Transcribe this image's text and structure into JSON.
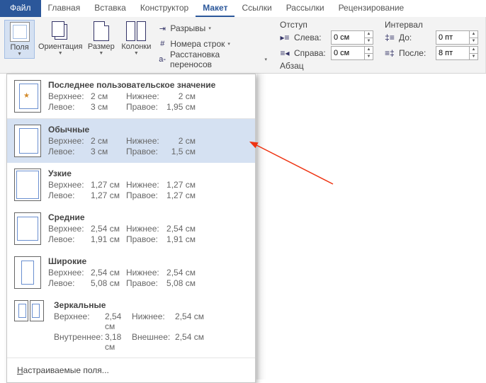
{
  "tabs": {
    "file": "Файл",
    "home": "Главная",
    "insert": "Вставка",
    "design": "Конструктор",
    "layout": "Макет",
    "references": "Ссылки",
    "mailings": "Рассылки",
    "review": "Рецензирование"
  },
  "ribbon": {
    "margins": "Поля",
    "orientation": "Ориентация",
    "size": "Размер",
    "columns": "Колонки",
    "breaks": "Разрывы",
    "linenumbers": "Номера строк",
    "hyphenation": "Расстановка переносов",
    "paragraph_label": "Абзац",
    "indent_label": "Отступ",
    "spacing_label": "Интервал",
    "left": "Слева:",
    "right": "Справа:",
    "before": "До:",
    "after": "После:",
    "left_v": "0 см",
    "right_v": "0 см",
    "before_v": "0 пт",
    "after_v": "8 пт"
  },
  "dropdown": {
    "top": "Верхнее:",
    "bottom": "Нижнее:",
    "left": "Левое:",
    "right": "Правое:",
    "inner": "Внутреннее:",
    "outer": "Внешнее:",
    "custom": "Настраиваемые поля...",
    "items": [
      {
        "title": "Последнее пользовательское значение",
        "top": "2 см",
        "bottom": "2 см",
        "left": "3 см",
        "right": "1,95 см"
      },
      {
        "title": "Обычные",
        "top": "2 см",
        "bottom": "2 см",
        "left": "3 см",
        "right": "1,5 см"
      },
      {
        "title": "Узкие",
        "top": "1,27 см",
        "bottom": "1,27 см",
        "left": "1,27 см",
        "right": "1,27 см"
      },
      {
        "title": "Средние",
        "top": "2,54 см",
        "bottom": "2,54 см",
        "left": "1,91 см",
        "right": "1,91 см"
      },
      {
        "title": "Широкие",
        "top": "2,54 см",
        "bottom": "2,54 см",
        "left": "5,08 см",
        "right": "5,08 см"
      },
      {
        "title": "Зеркальные",
        "top": "2,54 см",
        "bottom": "2,54 см",
        "left": "3,18 см",
        "right": "2,54 см"
      }
    ]
  }
}
